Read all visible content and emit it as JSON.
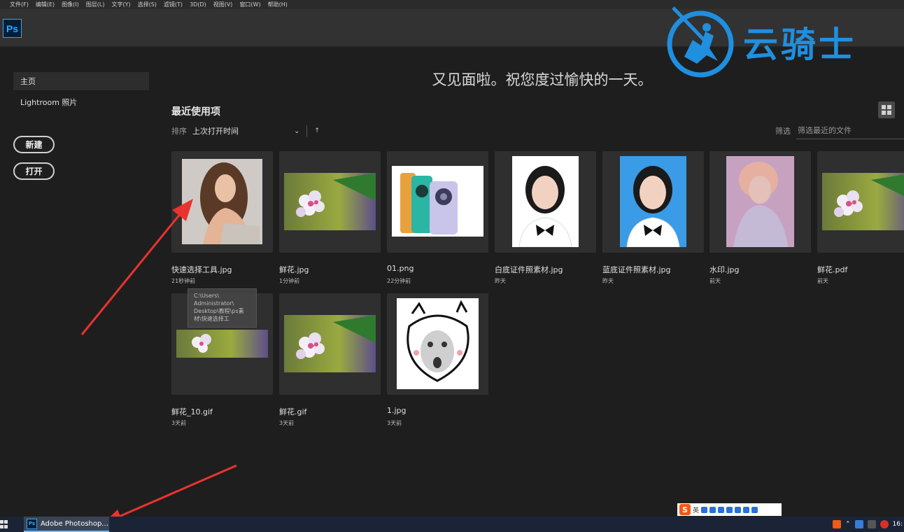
{
  "menu": [
    "文件(F)",
    "编辑(E)",
    "图像(I)",
    "图层(L)",
    "文字(Y)",
    "选择(S)",
    "滤镜(T)",
    "3D(D)",
    "视图(V)",
    "窗口(W)",
    "帮助(H)"
  ],
  "app": {
    "logo": "Ps"
  },
  "watermark": {
    "text": "云骑士",
    "color": "#1f8fe0"
  },
  "sidebar": {
    "items": [
      {
        "label": "主页",
        "active": true
      },
      {
        "label": "Lightroom 照片",
        "active": false
      }
    ],
    "new_button": "新建",
    "open_button": "打开"
  },
  "greeting": "又见面啦。祝您度过愉快的一天。",
  "recent": {
    "title": "最近使用项",
    "sort_label": "排序",
    "sort_value": "上次打开时间",
    "filter_label": "筛选",
    "filter_placeholder": "筛选最近的文件"
  },
  "files": [
    {
      "name": "快速选择工具.jpg",
      "time": "21秒钟前",
      "thumb": "woman"
    },
    {
      "name": "鲜花.jpg",
      "time": "1分钟前",
      "thumb": "flower"
    },
    {
      "name": "01.png",
      "time": "22分钟前",
      "thumb": "phone"
    },
    {
      "name": "白底证件照素材.jpg",
      "time": "昨天",
      "thumb": "id-white"
    },
    {
      "name": "蓝底证件照素材.jpg",
      "time": "昨天",
      "thumb": "id-blue"
    },
    {
      "name": "水印.jpg",
      "time": "前天",
      "thumb": "painting"
    },
    {
      "name": "鲜花.pdf",
      "time": "前天",
      "thumb": "flower"
    },
    {
      "name": "鲜花_10.gif",
      "time": "3天前",
      "thumb": "flower-small"
    },
    {
      "name": "鲜花.gif",
      "time": "3天前",
      "thumb": "flower"
    },
    {
      "name": "1.jpg",
      "time": "3天前",
      "thumb": "meme"
    }
  ],
  "tooltip": "C:\\Users\\\nAdministrator\\\nDesktop\\教程\\ps素\n材\\快速选择工",
  "ime": {
    "logo": "S",
    "lang": "英"
  },
  "taskbar": {
    "app_label": "Adobe Photoshop...",
    "app_icon": "Ps",
    "clock": "16:"
  }
}
